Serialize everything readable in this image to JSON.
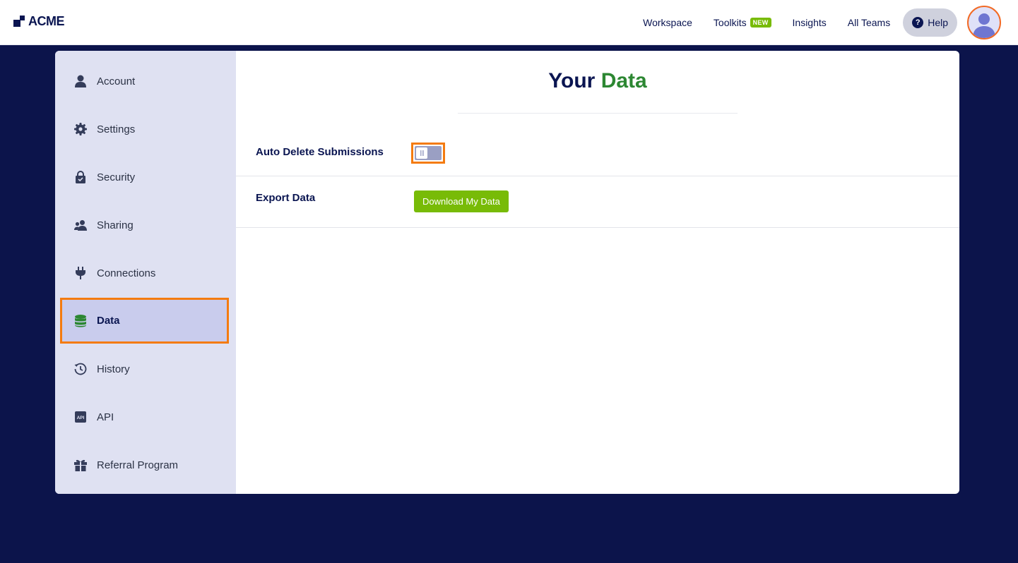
{
  "brand": {
    "name": "ACME"
  },
  "topnav": {
    "links": [
      {
        "label": "Workspace"
      },
      {
        "label": "Toolkits",
        "badge": "NEW"
      },
      {
        "label": "Insights"
      },
      {
        "label": "All Teams"
      }
    ],
    "help": {
      "icon": "?",
      "label": "Help"
    },
    "avatar": {
      "icon": "user-avatar-icon"
    }
  },
  "sidebar": {
    "items": [
      {
        "label": "Account",
        "icon": "user-icon"
      },
      {
        "label": "Settings",
        "icon": "gear-icon"
      },
      {
        "label": "Security",
        "icon": "lock-icon"
      },
      {
        "label": "Sharing",
        "icon": "users-icon"
      },
      {
        "label": "Connections",
        "icon": "plug-icon"
      },
      {
        "label": "Data",
        "icon": "database-icon",
        "active": true
      },
      {
        "label": "History",
        "icon": "history-icon"
      },
      {
        "label": "API",
        "icon": "api-icon"
      },
      {
        "label": "Referral Program",
        "icon": "gift-icon"
      }
    ]
  },
  "main": {
    "title_prefix": "Your",
    "title_accent": "Data",
    "auto_delete": {
      "label": "Auto Delete Submissions",
      "enabled": false
    },
    "export": {
      "label": "Export Data",
      "button_label": "Download My Data"
    }
  },
  "colors": {
    "navy": "#0a1551",
    "background": "#0c144b",
    "accent_green": "#2c8732",
    "button_green": "#78bb07",
    "highlight_orange": "#f47b10",
    "sidebar_bg": "#dfe1f2"
  }
}
